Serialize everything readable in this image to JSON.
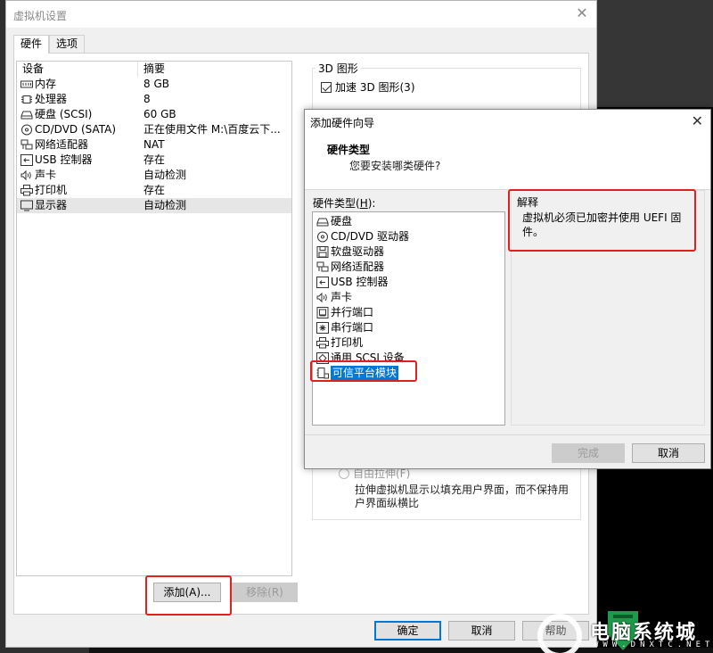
{
  "main_window": {
    "title": "虚拟机设置",
    "close_glyph": "✕",
    "tabs": [
      {
        "label": "硬件",
        "active": true
      },
      {
        "label": "选项",
        "active": false
      }
    ],
    "device_list": {
      "headers": {
        "device": "设备",
        "summary": "摘要"
      },
      "rows": [
        {
          "icon": "memory-icon",
          "device": "内存",
          "summary": "8 GB"
        },
        {
          "icon": "processor-icon",
          "device": "处理器",
          "summary": "8"
        },
        {
          "icon": "hard-disk-icon",
          "device": "硬盘 (SCSI)",
          "summary": "60 GB"
        },
        {
          "icon": "cd-dvd-icon",
          "device": "CD/DVD (SATA)",
          "summary": "正在使用文件 M:\\百度云下..."
        },
        {
          "icon": "network-adapter-icon",
          "device": "网络适配器",
          "summary": "NAT"
        },
        {
          "icon": "usb-icon",
          "device": "USB 控制器",
          "summary": "存在"
        },
        {
          "icon": "sound-card-icon",
          "device": "声卡",
          "summary": "自动检测"
        },
        {
          "icon": "printer-icon",
          "device": "打印机",
          "summary": "存在"
        },
        {
          "icon": "display-icon",
          "device": "显示器",
          "summary": "自动检测",
          "selected": true
        }
      ]
    },
    "add_button": "添加(A)...",
    "remove_button": "移除(R)",
    "ok_button": "确定",
    "cancel_button": "取消",
    "help_button": "帮助",
    "graphics_group": {
      "label": "3D 图形",
      "accelerate_checkbox": "加速 3D 图形(3)",
      "accelerate_checked": true
    },
    "display_group": {
      "free_stretch_radio": "自由拉伸(F)",
      "free_stretch_desc": "拉伸虚拟机显示以填充用户界面，而不保持用户界面纵横比"
    }
  },
  "wizard": {
    "title": "添加硬件向导",
    "close_glyph": "✕",
    "header_title": "硬件类型",
    "header_subtitle": "您要安装哪类硬件?",
    "list_label_prefix": "硬件类型(",
    "list_label_key": "H",
    "list_label_suffix": "):",
    "hardware_types": [
      {
        "icon": "hard-disk-icon",
        "label": "硬盘"
      },
      {
        "icon": "cd-dvd-icon",
        "label": "CD/DVD 驱动器"
      },
      {
        "icon": "floppy-icon",
        "label": "软盘驱动器"
      },
      {
        "icon": "network-adapter-icon",
        "label": "网络适配器"
      },
      {
        "icon": "usb-icon",
        "label": "USB 控制器"
      },
      {
        "icon": "sound-card-icon",
        "label": "声卡"
      },
      {
        "icon": "parallel-port-icon",
        "label": "并行端口"
      },
      {
        "icon": "serial-port-icon",
        "label": "串行端口"
      },
      {
        "icon": "printer-icon",
        "label": "打印机"
      },
      {
        "icon": "scsi-device-icon",
        "label": "通用 SCSI 设备"
      },
      {
        "icon": "tpm-icon",
        "label": "可信平台模块",
        "selected": true
      }
    ],
    "explanation_title": "解释",
    "explanation_text": "虚拟机必须已加密并使用 UEFI 固件。",
    "finish_button": "完成",
    "cancel_button": "取消"
  },
  "watermark": {
    "text": "电脑系统城",
    "url_text": "WWW.DNXTC.NET"
  },
  "colors": {
    "highlight_red": "#e02020",
    "selection_blue": "#0078d7",
    "watermark_green": "#1e9a4a"
  }
}
